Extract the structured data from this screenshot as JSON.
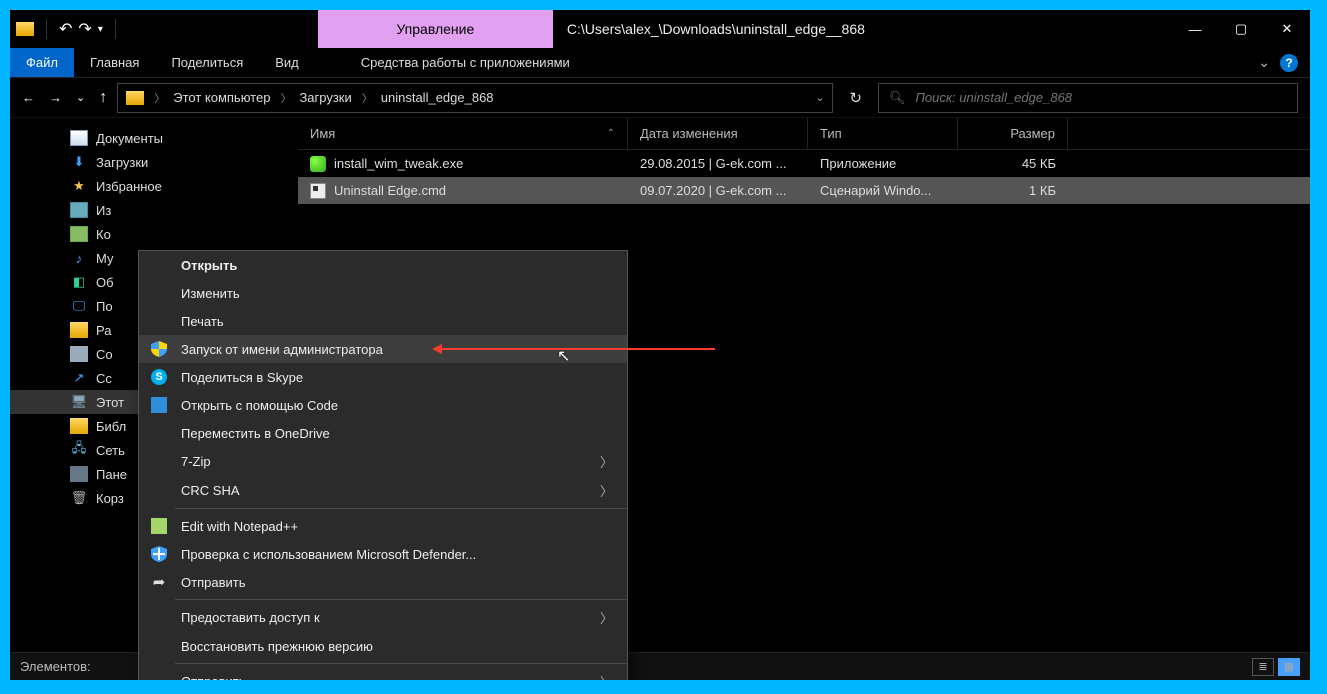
{
  "title_path": "C:\\Users\\alex_\\Downloads\\uninstall_edge__868",
  "ribbon_context_tab": "Управление",
  "tabs": {
    "file": "Файл",
    "home": "Главная",
    "share": "Поделиться",
    "view": "Вид",
    "manage": "Средства работы с приложениями"
  },
  "breadcrumbs": [
    "Этот компьютер",
    "Загрузки",
    "uninstall_edge_868"
  ],
  "search_placeholder": "Поиск: uninstall_edge_868",
  "columns": {
    "name": "Имя",
    "date": "Дата изменения",
    "type": "Тип",
    "size": "Размер"
  },
  "files": [
    {
      "name": "install_wim_tweak.exe",
      "date": "29.08.2015 | G-ek.com ...",
      "type": "Приложение",
      "size": "45 КБ",
      "icon": "fic-exe"
    },
    {
      "name": "Uninstall Edge.cmd",
      "date": "09.07.2020 | G-ek.com ...",
      "type": "Сценарий Windo...",
      "size": "1 КБ",
      "icon": "fic-cmd"
    }
  ],
  "tree": [
    {
      "label": "Документы",
      "icon": "ic-doc"
    },
    {
      "label": "Загрузки",
      "icon": "ic-dl",
      "glyph": "⬇"
    },
    {
      "label": "Избранное",
      "icon": "ic-star"
    },
    {
      "label": "Из",
      "icon": "ic-pic"
    },
    {
      "label": "Ко",
      "icon": "ic-crate"
    },
    {
      "label": "Му",
      "icon": "ic-music",
      "glyph": "♪"
    },
    {
      "label": "Об",
      "icon": "ic-3d",
      "glyph": "◧"
    },
    {
      "label": "По",
      "icon": "ic-desk",
      "glyph": "🖵"
    },
    {
      "label": "Ра",
      "icon": "ic-fold"
    },
    {
      "label": "Со",
      "icon": "ic-drive"
    },
    {
      "label": "Сс",
      "icon": "ic-link",
      "glyph": "↗"
    },
    {
      "label": "Этот",
      "icon": "ic-pc",
      "glyph": "🖥",
      "selected": true
    },
    {
      "label": "Библ",
      "icon": "ic-lib"
    },
    {
      "label": "Сеть",
      "icon": "ic-net",
      "glyph": "🖧"
    },
    {
      "label": "Пане",
      "icon": "ic-panel"
    },
    {
      "label": "Корз",
      "icon": "ic-bin",
      "glyph": "🗑"
    }
  ],
  "context_menu": [
    {
      "label": "Открыть",
      "bold": true
    },
    {
      "label": "Изменить"
    },
    {
      "label": "Печать"
    },
    {
      "label": "Запуск от имени администратора",
      "icon": "shield",
      "highlight": true
    },
    {
      "label": "Поделиться в Skype",
      "icon": "skype"
    },
    {
      "label": "Открыть с помощью Code",
      "icon": "vscode"
    },
    {
      "label": "Переместить в OneDrive"
    },
    {
      "label": "7-Zip",
      "submenu": true
    },
    {
      "label": "CRC SHA",
      "submenu": true
    },
    {
      "sep": true
    },
    {
      "label": "Edit with Notepad++",
      "icon": "notepp"
    },
    {
      "label": "Проверка с использованием Microsoft Defender...",
      "icon": "defender"
    },
    {
      "label": "Отправить",
      "icon": "share"
    },
    {
      "sep": true
    },
    {
      "label": "Предоставить доступ к",
      "submenu": true
    },
    {
      "label": "Восстановить прежнюю версию"
    },
    {
      "sep": true
    },
    {
      "label": "Отправить",
      "submenu": true
    }
  ],
  "status": "Элементов:"
}
